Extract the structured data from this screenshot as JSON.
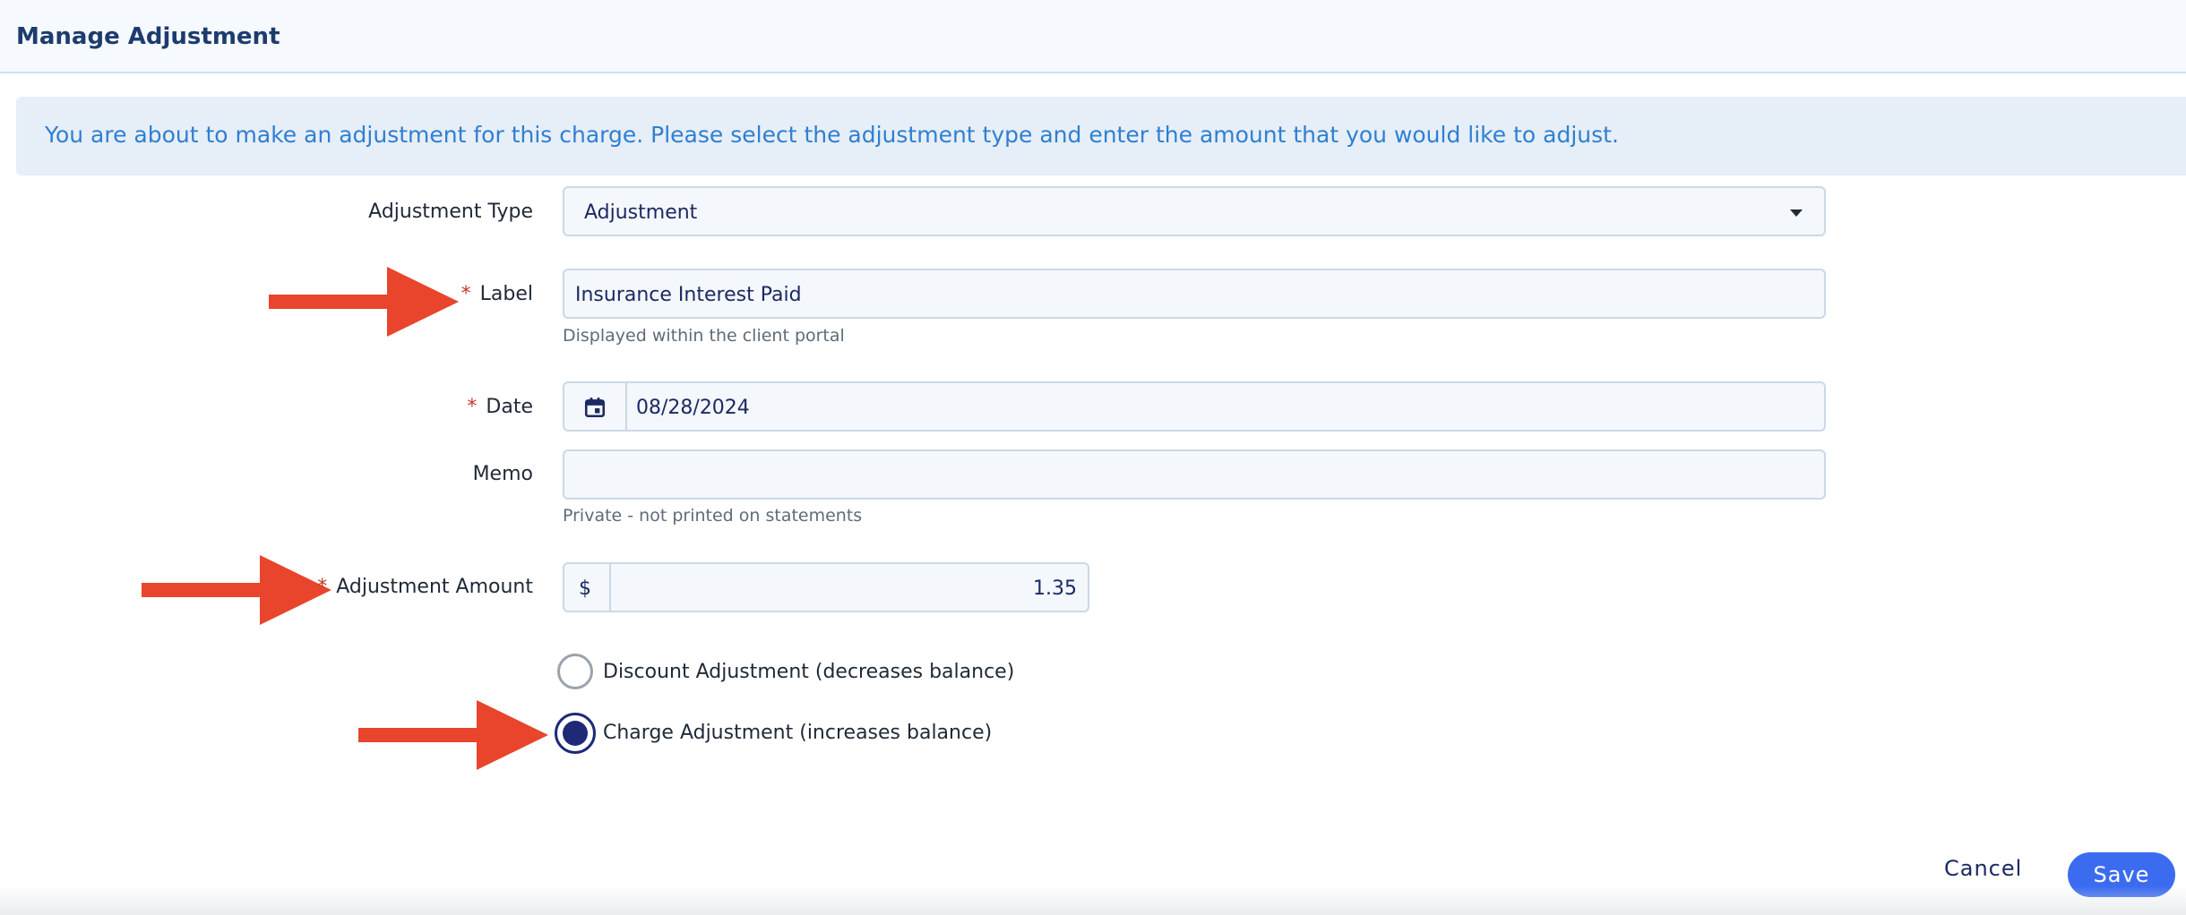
{
  "header": {
    "title": "Manage Adjustment"
  },
  "banner": {
    "text": "You are about to make an adjustment for this charge. Please select the adjustment type and enter the amount that you would like to adjust."
  },
  "form": {
    "adjustment_type": {
      "label": "Adjustment Type",
      "value": "Adjustment"
    },
    "label_field": {
      "required_marker": "*",
      "label": "Label",
      "value": "Insurance Interest Paid",
      "help": "Displayed within the client portal"
    },
    "date": {
      "required_marker": "*",
      "label": "Date",
      "value": "08/28/2024"
    },
    "memo": {
      "label": "Memo",
      "value": "",
      "help": "Private - not printed on statements"
    },
    "amount": {
      "required_marker": "*",
      "label": "Adjustment Amount",
      "currency": "$",
      "value": "1.35"
    },
    "direction": {
      "options": [
        {
          "label": "Discount Adjustment (decreases balance)",
          "selected": false
        },
        {
          "label": "Charge Adjustment (increases balance)",
          "selected": true
        }
      ]
    }
  },
  "actions": {
    "cancel_label": "Cancel",
    "save_label": "Save"
  },
  "colors": {
    "accent": "#3b6cf0",
    "header_title": "#1d3c6e",
    "banner_text": "#2f7fd1",
    "required": "#c0392b",
    "annotation_arrow": "#e8452c",
    "radio_selected": "#1e2a78"
  },
  "icons": {
    "calendar": "calendar-icon",
    "dropdown": "chevron-down-icon",
    "arrows": "red-arrow-annotation"
  }
}
